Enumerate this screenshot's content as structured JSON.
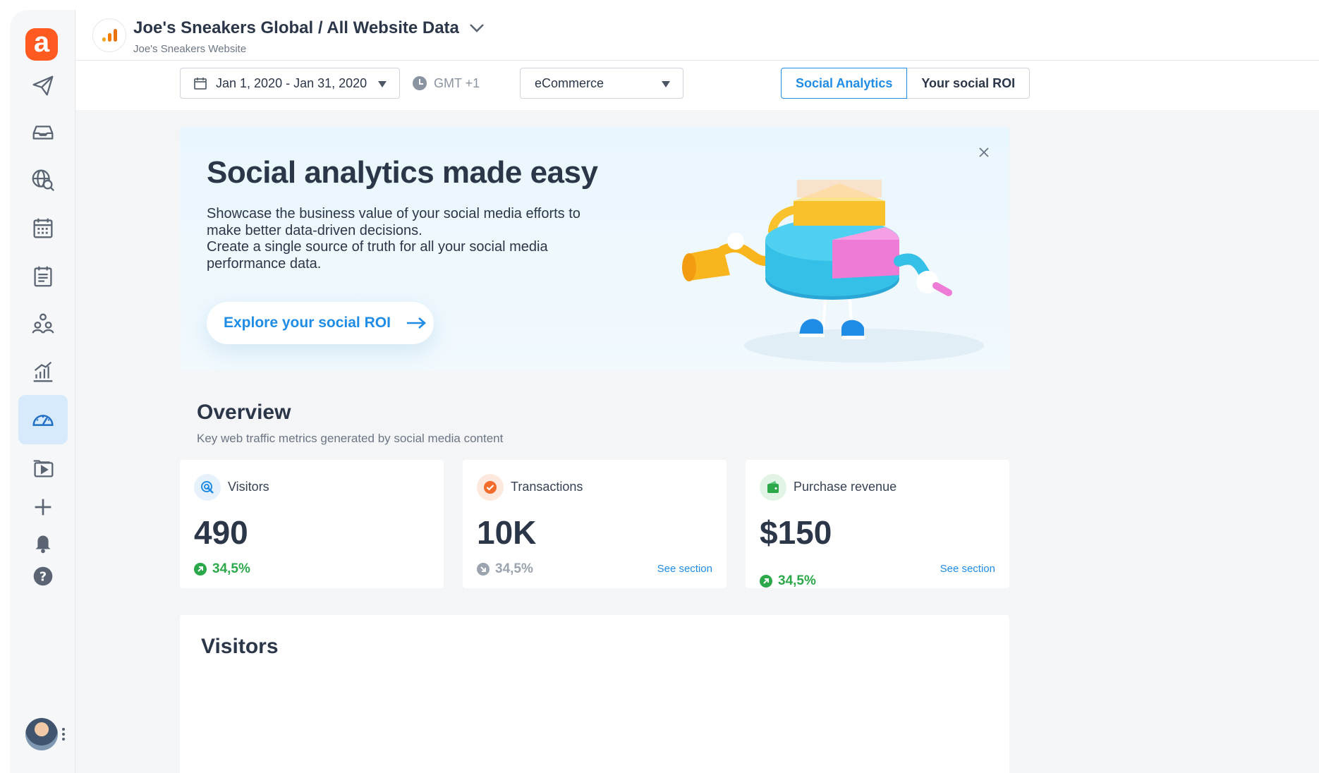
{
  "header": {
    "title": "Joe's Sneakers Global / All Website Data",
    "subtitle": "Joe's Sneakers Website"
  },
  "toolbar": {
    "date_range": "Jan 1, 2020 - Jan 31, 2020",
    "timezone": "GMT +1",
    "view_type": "eCommerce",
    "tabs": [
      {
        "label": "Social Analytics",
        "active": true
      },
      {
        "label": "Your social ROI",
        "active": false
      }
    ]
  },
  "banner": {
    "title": "Social analytics made easy",
    "paragraph_1": "Showcase the business value of your social media efforts to make better data-driven decisions.",
    "paragraph_2": "Create a single source of truth for all your social media performance data.",
    "cta_label": "Explore your social ROI"
  },
  "overview": {
    "title": "Overview",
    "subtitle": "Key web traffic metrics generated by social media content"
  },
  "metrics": [
    {
      "label": "Visitors",
      "value": "490",
      "change": "34,5%",
      "trend": "up",
      "link": ""
    },
    {
      "label": "Transactions",
      "value": "10K",
      "change": "34,5%",
      "trend": "neutral",
      "link": "See section"
    },
    {
      "label": "Purchase revenue",
      "value": "$150",
      "change": "34,5%",
      "trend": "up",
      "link": "See section"
    }
  ],
  "visitors_section": {
    "title": "Visitors"
  },
  "sidebar": {
    "logo_letter": "a",
    "items": [
      "publish-icon",
      "inbox-icon",
      "listening-icon",
      "calendar-icon",
      "planner-icon",
      "team-icon",
      "reports-icon",
      "dashboard-icon",
      "media-library-icon",
      "add-icon",
      "bell-icon",
      "help-icon"
    ]
  },
  "colors": {
    "brand": "#ff5a1f",
    "accent": "#1f8ce6",
    "positive": "#2ba84a",
    "neutral": "#9aa3ae"
  }
}
